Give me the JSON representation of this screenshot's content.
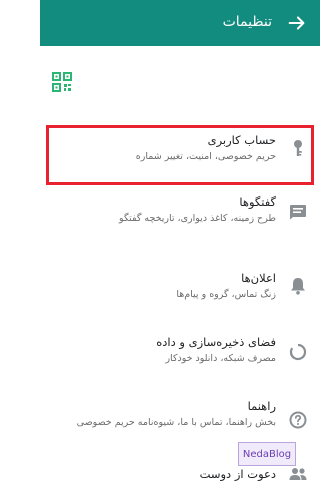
{
  "header": {
    "title": "تنظیمات",
    "bg_color": "#128c7e"
  },
  "qr": {
    "icon": "qr-code-icon"
  },
  "items": [
    {
      "label": "حساب کاربری",
      "sub": "حریم خصوصی، امنیت، تغییر شماره",
      "icon": "key-icon"
    },
    {
      "label": "گفتگوها",
      "sub": "طرح زمینه، کاغذ دیواری، تاریخچه گفتگو",
      "icon": "chat-icon"
    },
    {
      "label": "اعلان‌ها",
      "sub": "زنگ تماس، گروه و پیام‌ها",
      "icon": "bell-icon"
    },
    {
      "label": "فضای ذخیره‌سازی و داده",
      "sub": "مصرف شبکه، دانلود خودکار",
      "icon": "storage-icon"
    },
    {
      "label": "راهنما",
      "sub": "بخش راهنما، تماس با ما، شیوه‌نامه حریم خصوصی",
      "icon": "help-icon"
    },
    {
      "label": "دعوت از دوست",
      "sub": "",
      "icon": "people-icon"
    }
  ],
  "highlight_color": "#e8222e",
  "watermark": {
    "text": "NedaBlog"
  }
}
